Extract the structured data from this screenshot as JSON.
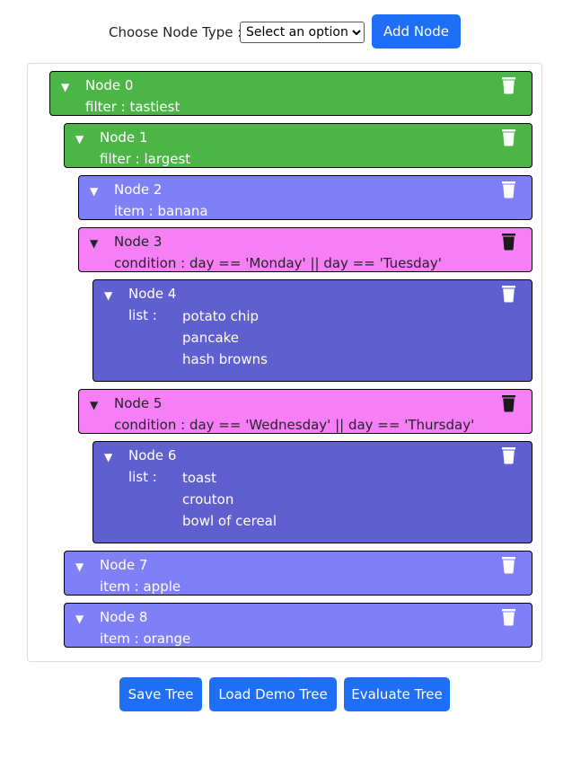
{
  "toolbar": {
    "choose_label": "Choose Node Type :",
    "select_value": "Select an option",
    "add_button": "Add Node"
  },
  "nodes": [
    {
      "title": "Node 0",
      "kind": "filter",
      "text": "filter : tastiest",
      "color": "#4db548"
    },
    {
      "title": "Node 1",
      "kind": "filter",
      "text": "filter : largest",
      "color": "#4db548"
    },
    {
      "title": "Node 2",
      "kind": "item",
      "text": "item : banana",
      "color": "#7f7ff6"
    },
    {
      "title": "Node 3",
      "kind": "condition",
      "text": "condition : day == 'Monday' || day == 'Tuesday'",
      "color": "#f77ff6"
    },
    {
      "title": "Node 4",
      "kind": "list",
      "list_label": "list :",
      "items": [
        "potato chip",
        "pancake",
        "hash browns"
      ],
      "color": "#5f5fcf"
    },
    {
      "title": "Node 5",
      "kind": "condition",
      "text": "condition : day == 'Wednesday' || day == 'Thursday'",
      "color": "#f77ff6"
    },
    {
      "title": "Node 6",
      "kind": "list",
      "list_label": "list :",
      "items": [
        "toast",
        "crouton",
        "bowl of cereal"
      ],
      "color": "#5f5fcf"
    },
    {
      "title": "Node 7",
      "kind": "item",
      "text": "item : apple",
      "color": "#7f7ff6"
    },
    {
      "title": "Node 8",
      "kind": "item",
      "text": "item : orange",
      "color": "#7f7ff6"
    }
  ],
  "icons": {
    "collapse": "triangle-down-icon",
    "delete": "trash-icon"
  },
  "footer": {
    "save_button": "Save Tree",
    "load_button": "Load Demo Tree",
    "evaluate_button": "Evaluate Tree"
  },
  "colors": {
    "button": "#1e6ff5"
  }
}
